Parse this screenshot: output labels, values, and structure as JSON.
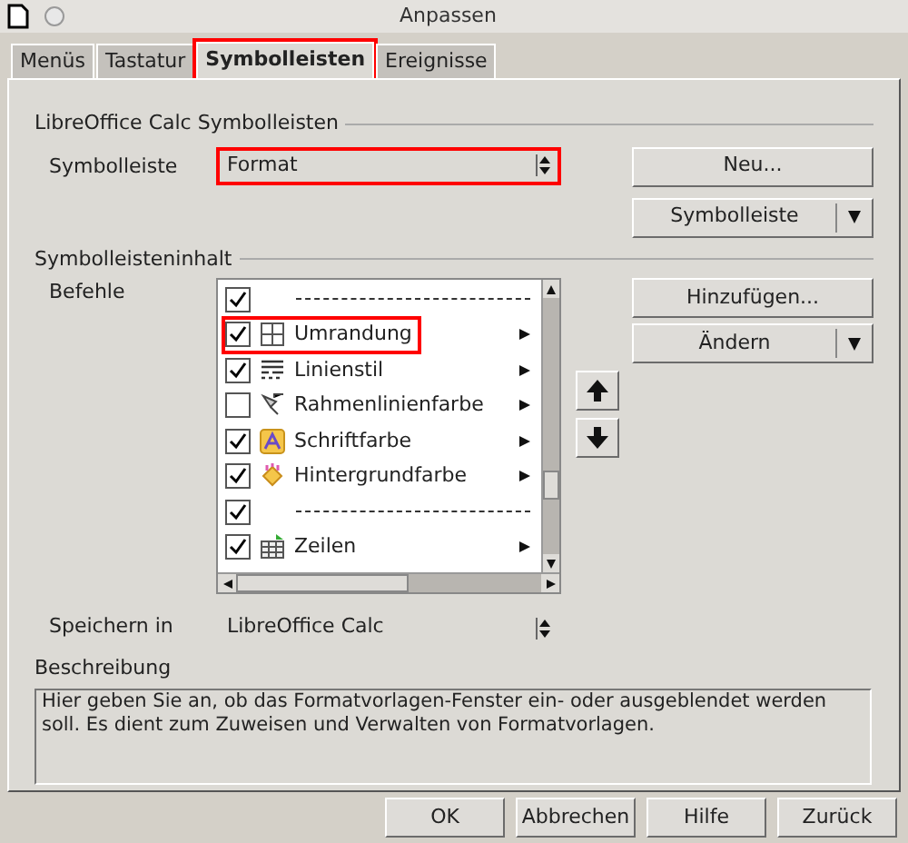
{
  "window": {
    "title": "Anpassen"
  },
  "tabs": [
    {
      "label": "Menüs",
      "selected": false,
      "highlighted": false
    },
    {
      "label": "Tastatur",
      "selected": false,
      "highlighted": false
    },
    {
      "label": "Symbolleisten",
      "selected": true,
      "highlighted": true
    },
    {
      "label": "Ereignisse",
      "selected": false,
      "highlighted": false
    }
  ],
  "toolbars_group": {
    "title": "LibreOffice Calc Symbolleisten",
    "label": "Symbolleiste",
    "select": {
      "value": "Format",
      "highlighted": true
    },
    "buttons": [
      {
        "label": "Neu...",
        "kind": "plain"
      },
      {
        "label": "Symbolleiste",
        "kind": "menu"
      }
    ]
  },
  "content_group": {
    "title": "Symbolleisteninhalt",
    "label": "Befehle",
    "commands": [
      {
        "kind": "separator",
        "checked": true,
        "highlighted": false
      },
      {
        "kind": "command",
        "label": "Umrandung",
        "checked": true,
        "highlighted": true,
        "submenu": true
      },
      {
        "kind": "command",
        "label": "Linienstil",
        "checked": true,
        "highlighted": false,
        "submenu": true
      },
      {
        "kind": "command",
        "label": "Rahmenlinienfarbe",
        "checked": false,
        "highlighted": false,
        "submenu": true
      },
      {
        "kind": "command",
        "label": "Schriftfarbe",
        "checked": true,
        "highlighted": false,
        "submenu": true
      },
      {
        "kind": "command",
        "label": "Hintergrundfarbe",
        "checked": true,
        "highlighted": false,
        "submenu": true
      },
      {
        "kind": "separator",
        "checked": true,
        "highlighted": false
      },
      {
        "kind": "command",
        "label": "Zeilen",
        "checked": true,
        "highlighted": false,
        "submenu": true
      }
    ],
    "buttons": [
      {
        "label": "Hinzufügen...",
        "kind": "plain"
      },
      {
        "label": "Ändern",
        "kind": "menu"
      }
    ]
  },
  "save_in": {
    "label": "Speichern in",
    "value": "LibreOffice Calc"
  },
  "description": {
    "label": "Beschreibung",
    "text": "Hier geben Sie an, ob das Formatvorlagen-Fenster ein- oder ausgeblendet werden soll. Es dient zum Zuweisen und Verwalten von Formatvorlagen."
  },
  "footer_buttons": [
    "OK",
    "Abbrechen",
    "Hilfe",
    "Zurück"
  ]
}
